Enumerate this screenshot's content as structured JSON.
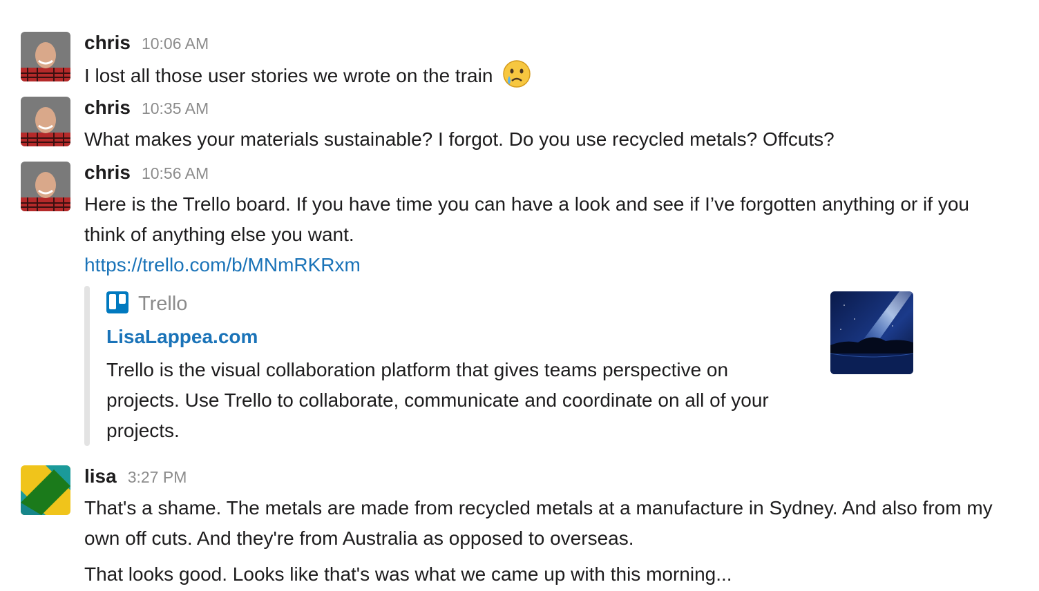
{
  "messages": [
    {
      "author": "chris",
      "time": "10:06 AM",
      "text": "I lost all those user stories we wrote on the train",
      "emoji": "crying-face"
    },
    {
      "author": "chris",
      "time": "10:35 AM",
      "text": "What makes your materials sustainable? I forgot. Do you use recycled metals? Offcuts?"
    },
    {
      "author": "chris",
      "time": "10:56 AM",
      "text": "Here is the Trello board. If you have time you can have a look and see if I’ve forgotten anything or if you think of anything else you want.",
      "link": "https://trello.com/b/MNmRKRxm",
      "attachment": {
        "service": "Trello",
        "service_icon": "trello-icon",
        "title": "LisaLappea.com",
        "description": "Trello is the visual collaboration platform that gives teams perspective on projects. Use Trello to collaborate, communicate and coordinate on all of your projects."
      }
    },
    {
      "author": "lisa",
      "time": "3:27 PM",
      "text": "That's a shame. The metals are made from recycled metals at a manufacture in Sydney. And also from my own off cuts. And they're from Australia as opposed to overseas.",
      "followup": "That looks good. Looks like that's was what we came up with this morning..."
    }
  ],
  "colors": {
    "link": "#1a73b8",
    "timestamp": "#8b8b8b",
    "text": "#1d1c1d"
  }
}
